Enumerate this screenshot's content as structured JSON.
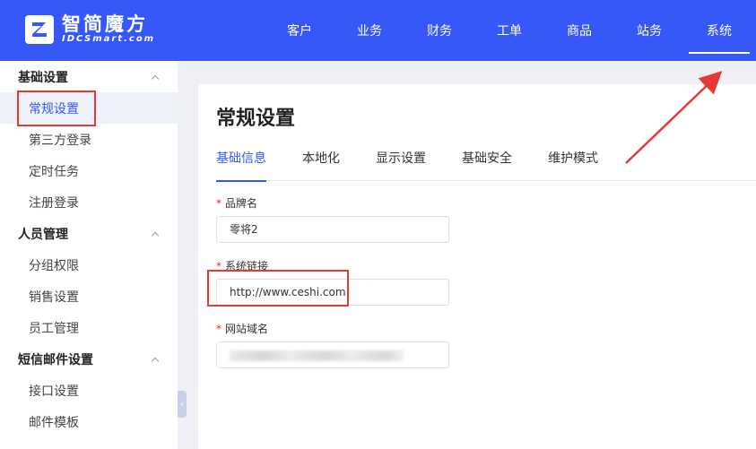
{
  "brand": {
    "name_cn": "智简魔方",
    "name_en": "IDCSmart.com"
  },
  "nav": {
    "items": [
      {
        "label": "客户"
      },
      {
        "label": "业务"
      },
      {
        "label": "财务"
      },
      {
        "label": "工单"
      },
      {
        "label": "商品"
      },
      {
        "label": "站务"
      },
      {
        "label": "系统",
        "active": true
      }
    ]
  },
  "sidebar": {
    "groups": [
      {
        "label": "基础设置",
        "items": [
          {
            "label": "常规设置",
            "active": true
          },
          {
            "label": "第三方登录"
          },
          {
            "label": "定时任务"
          },
          {
            "label": "注册登录"
          }
        ]
      },
      {
        "label": "人员管理",
        "items": [
          {
            "label": "分组权限"
          },
          {
            "label": "销售设置"
          },
          {
            "label": "员工管理"
          }
        ]
      },
      {
        "label": "短信邮件设置",
        "items": [
          {
            "label": "接口设置"
          },
          {
            "label": "邮件模板"
          }
        ]
      }
    ]
  },
  "page": {
    "title": "常规设置",
    "tabs": [
      {
        "label": "基础信息",
        "active": true
      },
      {
        "label": "本地化"
      },
      {
        "label": "显示设置"
      },
      {
        "label": "基础安全"
      },
      {
        "label": "维护模式"
      }
    ],
    "form": {
      "required_mark": "*",
      "brand_label": "品牌名",
      "brand_value": "零将2",
      "link_label": "系统链接",
      "link_value": "http://www.ceshi.com",
      "domain_label": "网站域名"
    }
  },
  "colors": {
    "header": "#3758f9",
    "accent": "#3758f9",
    "annotation": "#e53935"
  }
}
